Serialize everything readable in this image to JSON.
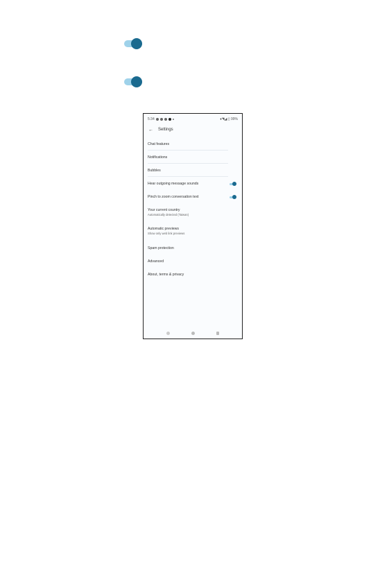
{
  "document": {
    "toggles": [
      {
        "name": "toggle-1",
        "state": "on"
      },
      {
        "name": "toggle-2",
        "state": "on"
      }
    ]
  },
  "phone": {
    "statusbar": {
      "time": "5:34",
      "right": "♦◥◢ ▯ 99%"
    },
    "appbar": {
      "back_icon": "←",
      "title": "Settings"
    },
    "items": {
      "chat_features": "Chat features",
      "notifications": "Notifications",
      "bubbles": "Bubbles",
      "outgoing_sounds": "Hear outgoing message sounds",
      "pinch_zoom": "Pinch to zoom conversation text",
      "country_title": "Your current country",
      "country_sub": "Automatically detected (Taiwan)",
      "previews_title": "Automatic previews",
      "previews_sub": "Show only web link previews",
      "spam": "Spam protection",
      "advanced": "Advanced",
      "about": "About, terms & privacy"
    },
    "toggle_states": {
      "outgoing_sounds": "on",
      "pinch_zoom": "on"
    }
  },
  "colors": {
    "toggle_thumb": "#1a6a8f",
    "toggle_track": "#9fd2ea"
  }
}
